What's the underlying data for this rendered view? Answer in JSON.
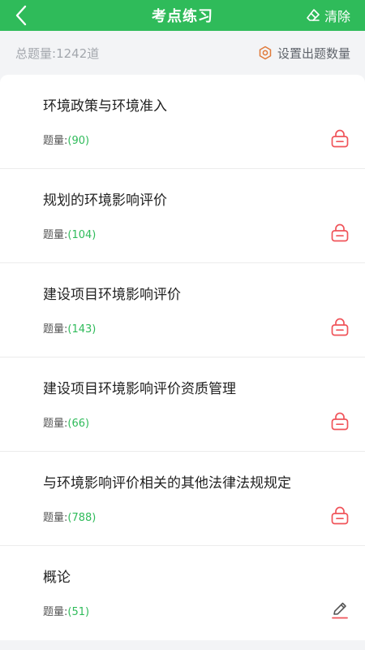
{
  "header": {
    "title": "考点练习",
    "clear_label": "清除"
  },
  "subbar": {
    "total_label": "总题量:",
    "total_value": "1242道",
    "set_count_label": "设置出题数量"
  },
  "count_label": "题量:",
  "items": [
    {
      "title": "环境政策与环境准入",
      "count": "(90)",
      "icon": "lock-icon"
    },
    {
      "title": "规划的环境影响评价",
      "count": "(104)",
      "icon": "lock-icon"
    },
    {
      "title": "建设项目环境影响评价",
      "count": "(143)",
      "icon": "lock-icon"
    },
    {
      "title": "建设项目环境影响评价资质管理",
      "count": "(66)",
      "icon": "lock-icon"
    },
    {
      "title": "与环境影响评价相关的其他法律法规规定",
      "count": "(788)",
      "icon": "lock-icon"
    },
    {
      "title": "概论",
      "count": "(51)",
      "icon": "pencil-icon"
    }
  ],
  "colors": {
    "brand_green": "#2fbb5a",
    "lock_red": "#f0545a",
    "pencil_underline": "#f0545a"
  }
}
